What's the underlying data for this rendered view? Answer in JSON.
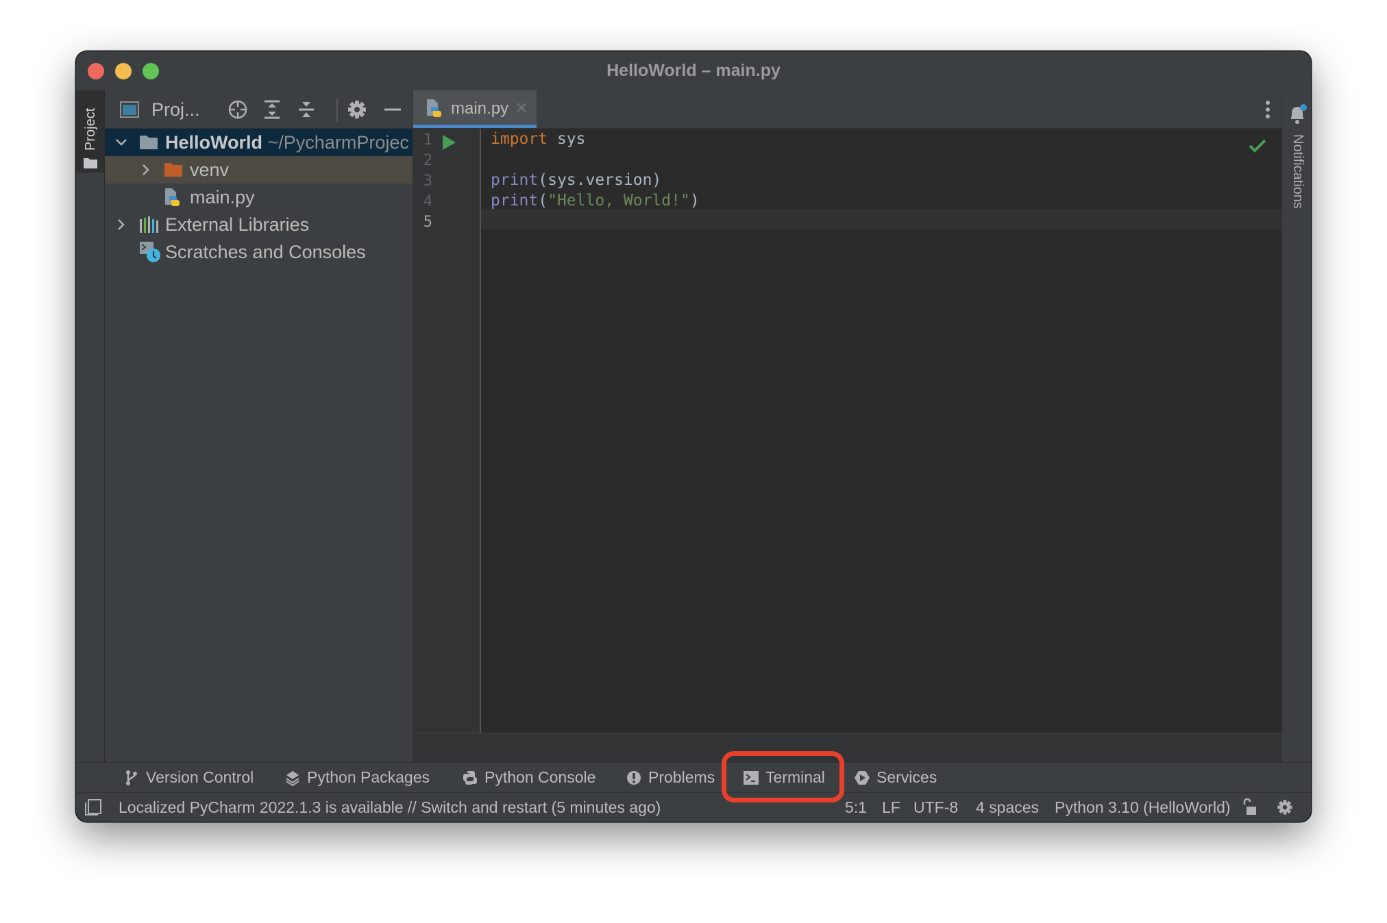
{
  "window": {
    "title": "HelloWorld – main.py",
    "traffic_lights": [
      "close",
      "minimize",
      "zoom"
    ]
  },
  "left_strip": {
    "project_tab_label": "Project"
  },
  "project_panel": {
    "title": "Proj...",
    "toolbar_icons": [
      "locate-icon",
      "expand-all-icon",
      "collapse-all-icon",
      "gear-icon",
      "hide-icon"
    ],
    "tree": [
      {
        "label": "HelloWorld",
        "path": "~/PycharmProjec",
        "type": "project-folder",
        "expanded": true,
        "selected": true
      },
      {
        "label": "venv",
        "type": "excluded-folder",
        "expanded": false
      },
      {
        "label": "main.py",
        "type": "python-file"
      },
      {
        "label": "External Libraries",
        "type": "libraries",
        "expanded": false
      },
      {
        "label": "Scratches and Consoles",
        "type": "scratches"
      }
    ]
  },
  "editor": {
    "tabs": [
      {
        "label": "main.py",
        "active": true,
        "closable": true
      }
    ],
    "line_numbers": [
      "1",
      "2",
      "3",
      "4",
      "5"
    ],
    "current_line": 5,
    "code": {
      "line1": {
        "keyword": "import",
        "rest": " sys"
      },
      "line2": "",
      "line3": {
        "builtin": "print",
        "rest": "(sys.version)"
      },
      "line4": {
        "builtin": "print",
        "open": "(",
        "string": "\"Hello, World!\"",
        "close": ")"
      },
      "line5": ""
    },
    "inspection_status": "no-problems"
  },
  "right_strip": {
    "notifications_label": "Notifications",
    "has_unread": true
  },
  "tool_windows": [
    {
      "label": "Version Control",
      "icon": "branch-icon"
    },
    {
      "label": "Python Packages",
      "icon": "layers-icon"
    },
    {
      "label": "Python Console",
      "icon": "python-icon"
    },
    {
      "label": "Problems",
      "icon": "exclamation-icon"
    },
    {
      "label": "Terminal",
      "icon": "terminal-icon",
      "highlighted": true
    },
    {
      "label": "Services",
      "icon": "play-hexagon-icon"
    }
  ],
  "status_bar": {
    "message": "Localized PyCharm 2022.1.3 is available // Switch and restart (5 minutes ago)",
    "caret_position": "5:1",
    "line_separator": "LF",
    "encoding": "UTF-8",
    "indent": "4 spaces",
    "interpreter": "Python 3.10 (HelloWorld)"
  },
  "colors": {
    "highlight": "#e8402b",
    "tab_underline": "#4a88c7",
    "keyword": "#cc7832",
    "builtin": "#8888c6",
    "string": "#6a8759"
  }
}
